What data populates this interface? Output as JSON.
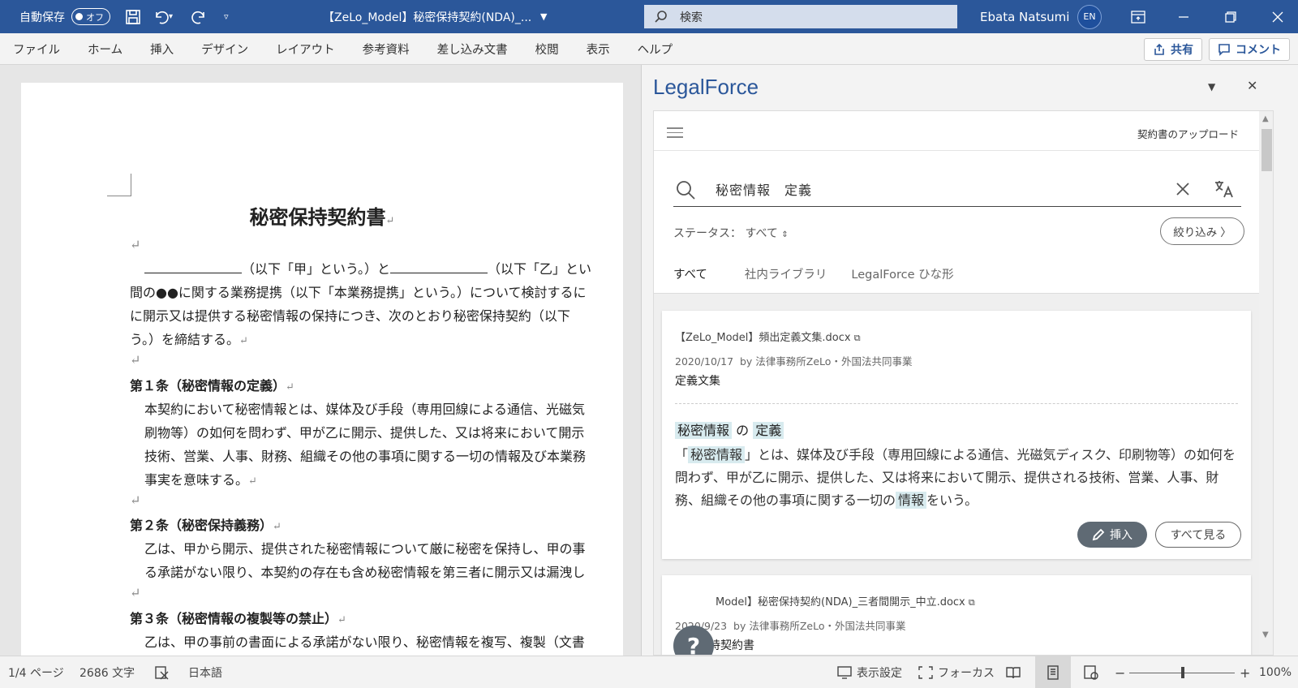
{
  "titlebar": {
    "autosave_label": "自動保存",
    "autosave_state": "オフ",
    "doc_title": "【ZeLo_Model】秘密保持契約(NDA)_...",
    "search_placeholder": "検索",
    "user_name": "Ebata Natsumi",
    "user_initials": "EN",
    "bg_color": "#2b579a"
  },
  "ribbon": {
    "tabs": [
      "ファイル",
      "ホーム",
      "挿入",
      "デザイン",
      "レイアウト",
      "参考資料",
      "差し込み文書",
      "校閲",
      "表示",
      "ヘルプ"
    ],
    "share_label": "共有",
    "comment_label": "コメント"
  },
  "document": {
    "title": "秘密保持契約書",
    "pilcrow": "↵",
    "intro_1a": "（以下「甲」という。）と",
    "intro_1b": "（以下「乙」とい",
    "intro_2": "間の●●に関する業務提携（以下「本業務提携」という。）について検討するに",
    "intro_3": "に開示又は提供する秘密情報の保持につき、次のとおり秘密保持契約（以下",
    "intro_4": "う。）を締結する。",
    "art1_heading": "第１条（秘密情報の定義）",
    "art1_l1": "本契約において秘密情報とは、媒体及び手段（専用回線による通信、光磁気",
    "art1_l2": "刷物等）の如何を問わず、甲が乙に開示、提供した、又は将来において開示",
    "art1_l3": "技術、営業、人事、財務、組織その他の事項に関する一切の情報及び本業務",
    "art1_l4": "事実を意味する。",
    "art2_heading": "第２条（秘密保持義務）",
    "art2_l1": "乙は、甲から開示、提供された秘密情報について厳に秘密を保持し、甲の事",
    "art2_l2": "る承諾がない限り、本契約の存在も含め秘密情報を第三者に開示又は漏洩し",
    "art3_heading": "第３条（秘密情報の複製等の禁止）",
    "art3_l1": "乙は、甲の事前の書面による承諾がない限り、秘密情報を複写、複製（文書"
  },
  "pane": {
    "title": "LegalForce",
    "upload_label": "契約書のアップロード",
    "search_query": "秘密情報　定義",
    "status_label": "ステータス：",
    "status_value": "すべて",
    "filter_label": "絞り込み",
    "tabs": [
      "すべて",
      "社内ライブラリ",
      "LegalForce ひな形"
    ],
    "result1": {
      "file": "【ZeLo_Model】頻出定義文集.docx",
      "date": "2020/10/17",
      "by": "by 法律事務所ZeLo・外国法共同事業",
      "category": "定義文集",
      "head_term1": "秘密情報",
      "head_mid": "の",
      "head_term2": "定義",
      "body_p1": "「",
      "body_t1": "秘密情報",
      "body_p2": "」とは、媒体及び手段（専用回線による通信、光磁気ディスク、印刷物等）の如何を問わず、甲が乙に開示、提供した、又は将来において開示、提供される技術、営業、人事、財務、組織その他の事項に関する一切の",
      "body_t2": "情報",
      "body_p3": "をいう。",
      "insert_label": "挿入",
      "see_all_label": "すべて見る"
    },
    "result2": {
      "file": "Model】秘密保持契約(NDA)_三者間開示_中立.docx",
      "date": "2020/9/23",
      "by": "by 法律事務所ZeLo・外国法共同事業",
      "category": "秘密保持契約書"
    },
    "help_label": "?",
    "highlight_color": "#d8ebef"
  },
  "statusbar": {
    "page": "1/4 ページ",
    "words": "2686 文字",
    "language": "日本語",
    "display_settings": "表示設定",
    "focus": "フォーカス",
    "zoom_minus": "−",
    "zoom_plus": "+",
    "zoom": "100%"
  }
}
